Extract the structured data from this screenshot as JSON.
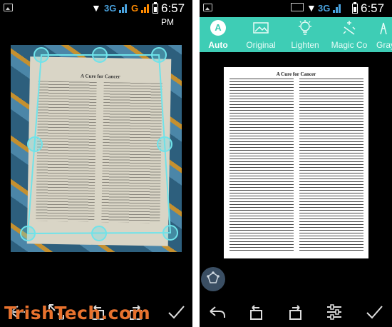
{
  "status_bar": {
    "network_1": "3G",
    "network_2": "G",
    "time": "6:57",
    "time_suffix": "PM"
  },
  "crop_screen": {
    "page_title": "A Cure for Cancer"
  },
  "filter_screen": {
    "filters": [
      {
        "label": "Auto",
        "icon": "auto-icon",
        "active": true,
        "glyph": "A"
      },
      {
        "label": "Original",
        "icon": "image-icon",
        "active": false
      },
      {
        "label": "Lighten",
        "icon": "bulb-icon",
        "active": false
      },
      {
        "label": "Magic Co",
        "icon": "magic-icon",
        "active": false
      },
      {
        "label": "Gray",
        "icon": "gray-icon",
        "active": false
      }
    ],
    "page_title": "A Cure for Cancer"
  },
  "watermark": "TrishTech.com",
  "colors": {
    "accent": "#3ecdb5",
    "handle": "#6fe3ea",
    "watermark": "#e8722e"
  }
}
